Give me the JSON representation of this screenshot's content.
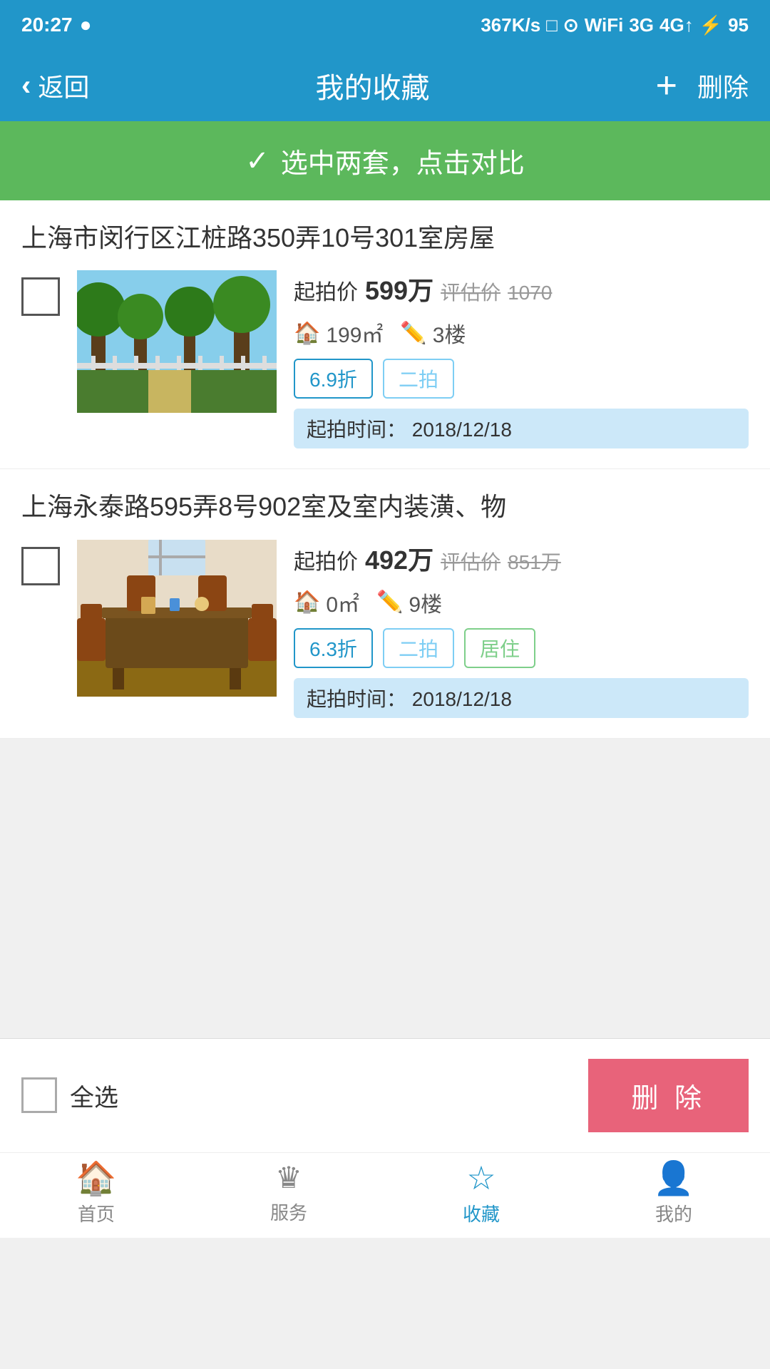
{
  "statusBar": {
    "time": "20:27",
    "network": "367K/s",
    "signal4g": "4G",
    "battery": "95"
  },
  "nav": {
    "backLabel": "返回",
    "title": "我的收藏",
    "addIcon": "+",
    "deleteLabel": "删除"
  },
  "compareBanner": {
    "text": "选中两套，点击对比"
  },
  "properties": [
    {
      "id": "prop1",
      "title": "上海市闵行区江桩路350弄10号301室房屋",
      "startPriceLabel": "起拍价",
      "startPrice": "599万",
      "estimateLabel": "评估价",
      "estimatePrice": "1070",
      "area": "199㎡",
      "floor": "3楼",
      "tags": [
        "6.9折",
        "二拍"
      ],
      "auctionTimeLabel": "起拍时间：",
      "auctionTime": "2018/12/18"
    },
    {
      "id": "prop2",
      "title": "上海永泰路595弄8号902室及室内装潢、物",
      "startPriceLabel": "起拍价",
      "startPrice": "492万",
      "estimateLabel": "评估价",
      "estimatePrice": "851万",
      "area": "0㎡",
      "floor": "9楼",
      "tags": [
        "6.3折",
        "二拍",
        "居住"
      ],
      "auctionTimeLabel": "起拍时间：",
      "auctionTime": "2018/12/18"
    }
  ],
  "bottomBar": {
    "selectAllLabel": "全选",
    "deleteLabel": "删 除"
  },
  "tabBar": {
    "tabs": [
      {
        "id": "home",
        "icon": "🏠",
        "label": "首页",
        "active": false
      },
      {
        "id": "service",
        "icon": "♛",
        "label": "服务",
        "active": false
      },
      {
        "id": "favorites",
        "icon": "☆",
        "label": "收藏",
        "active": true
      },
      {
        "id": "mine",
        "icon": "👤",
        "label": "我的",
        "active": false
      }
    ]
  }
}
